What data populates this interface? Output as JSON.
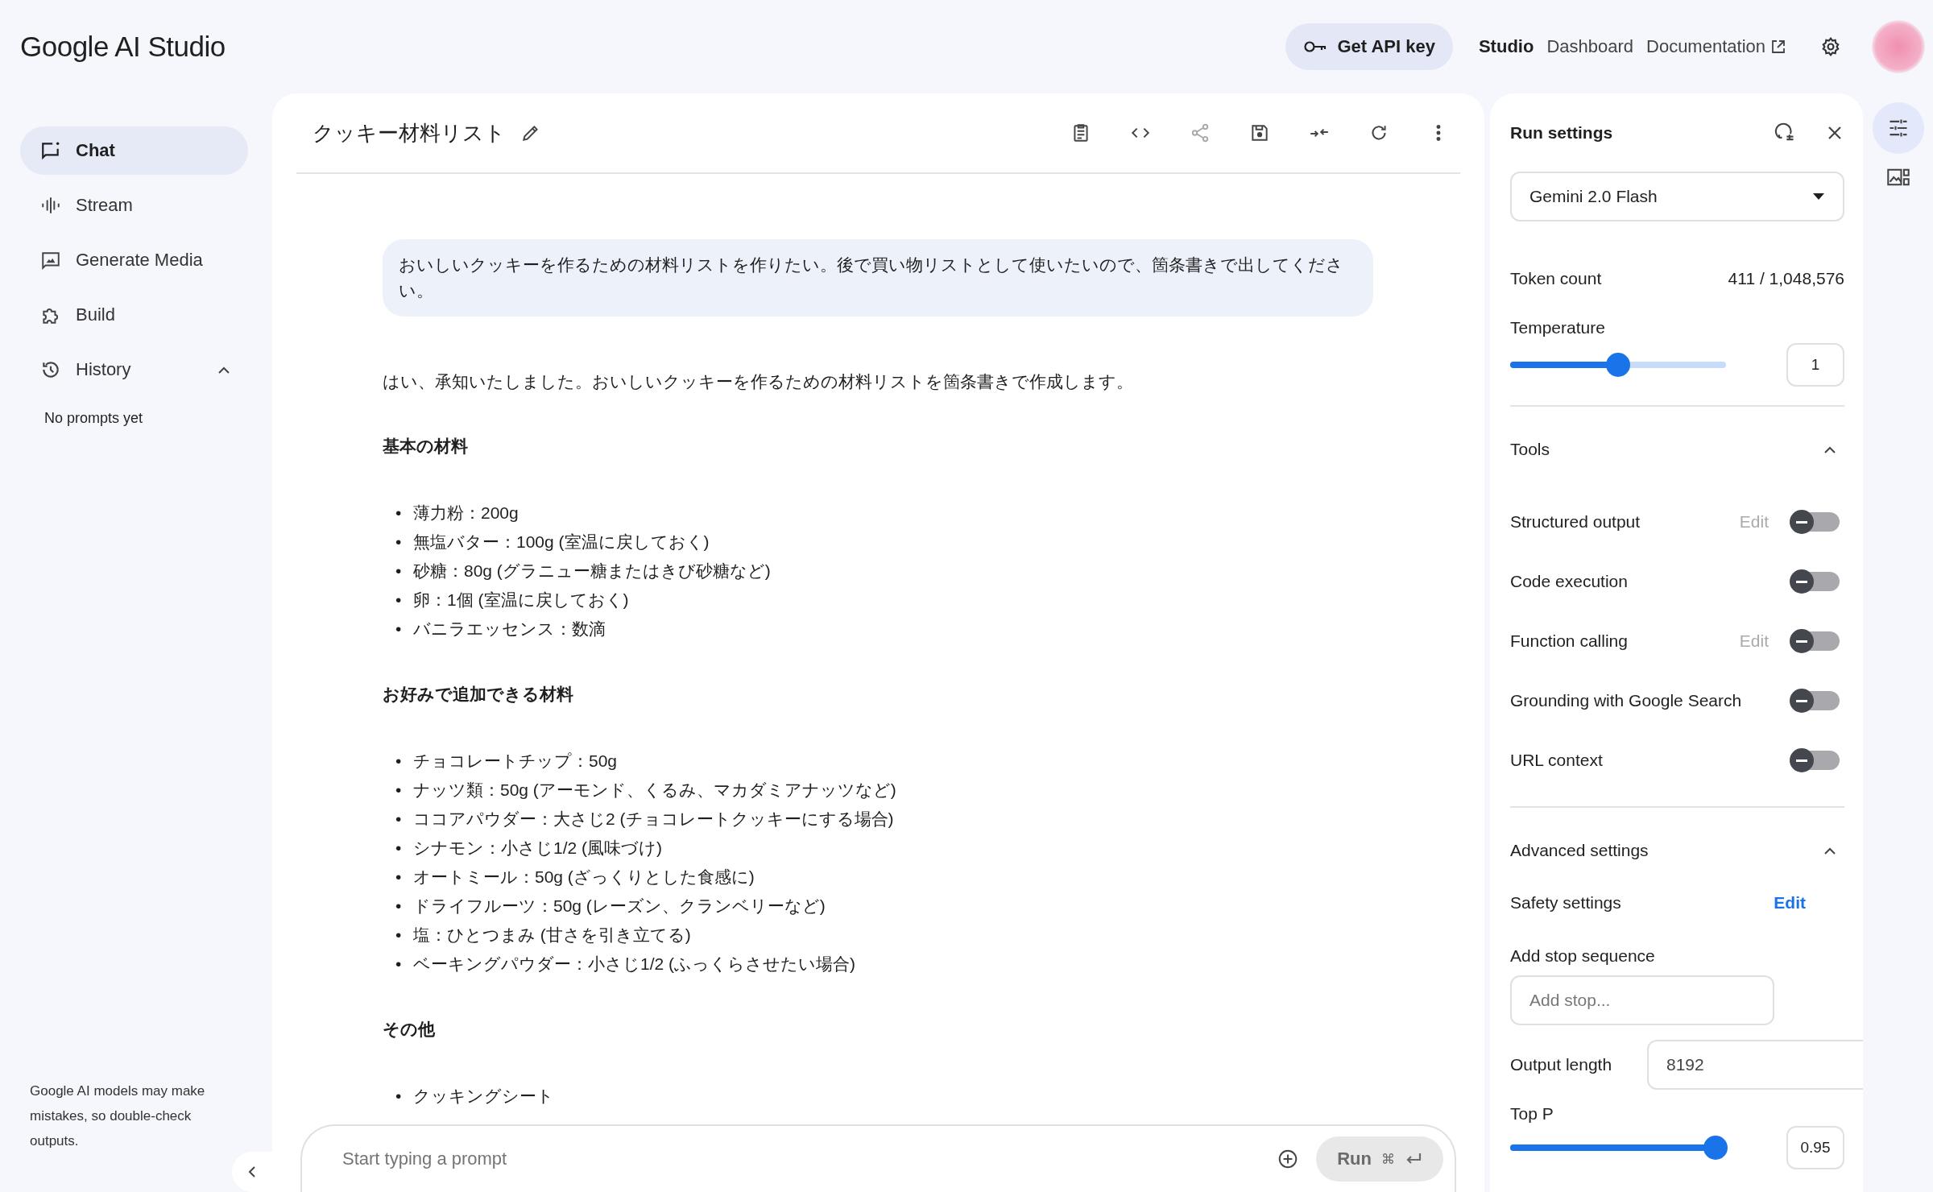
{
  "header": {
    "logo": "Google AI Studio",
    "api_key_button": "Get API key",
    "nav": [
      {
        "label": "Studio",
        "selected": true,
        "external": false
      },
      {
        "label": "Dashboard",
        "selected": false,
        "external": false
      },
      {
        "label": "Documentation",
        "selected": false,
        "external": true
      }
    ]
  },
  "sidebar": {
    "items": [
      {
        "label": "Chat",
        "selected": true
      },
      {
        "label": "Stream",
        "selected": false
      },
      {
        "label": "Generate Media",
        "selected": false
      },
      {
        "label": "Build",
        "selected": false
      },
      {
        "label": "History",
        "selected": false,
        "expanded": true
      }
    ],
    "history_empty": "No prompts yet",
    "disclaimer": "Google AI models may make mistakes, so double-check outputs."
  },
  "chat": {
    "title": "クッキー材料リスト",
    "user_message": "おいしいクッキーを作るための材料リストを作りたい。後で買い物リストとして使いたいので、箇条書きで出してください。",
    "response": [
      {
        "kind": "paragraph",
        "text": "はい、承知いたしました。おいしいクッキーを作るための材料リストを箇条書きで作成します。"
      },
      {
        "kind": "heading",
        "text": "基本の材料"
      },
      {
        "kind": "list",
        "marker": "•",
        "items": [
          "薄力粉：200g",
          "無塩バター：100g (室温に戻しておく)",
          "砂糖：80g (グラニュー糖またはきび砂糖など)",
          "卵：1個 (室温に戻しておく)",
          "バニラエッセンス：数滴"
        ]
      },
      {
        "kind": "heading",
        "text": "お好みで追加できる材料"
      },
      {
        "kind": "list",
        "marker": "•",
        "items": [
          "チョコレートチップ：50g",
          "ナッツ類：50g (アーモンド、くるみ、マカダミアナッツなど)",
          "ココアパウダー：大さじ2 (チョコレートクッキーにする場合)",
          "シナモン：小さじ1/2 (風味づけ)",
          "オートミール：50g (ざっくりとした食感に)",
          "ドライフルーツ：50g (レーズン、クランベリーなど)",
          "塩：ひとつまみ (甘さを引き立てる)",
          "ベーキングパウダー：小さじ1/2 (ふっくらさせたい場合)"
        ]
      },
      {
        "kind": "heading",
        "text": "その他"
      },
      {
        "kind": "list",
        "marker": "•",
        "items": [
          "クッキングシート"
        ]
      }
    ],
    "prompt": {
      "placeholder": "Start typing a prompt"
    },
    "run_button": "Run",
    "shortcut": "⌘"
  },
  "run_settings": {
    "title": "Run settings",
    "model": "Gemini 2.0 Flash",
    "token_count_label": "Token count",
    "token_count": "411 / 1,048,576",
    "temperature": {
      "label": "Temperature",
      "level": 0.5,
      "value": "1"
    },
    "tools": {
      "title": "Tools",
      "expanded": true,
      "items": [
        {
          "label": "Structured output",
          "edit": {
            "label": "Edit",
            "disabled": true
          },
          "on": false
        },
        {
          "label": "Code execution",
          "on": false
        },
        {
          "label": "Function calling",
          "edit": {
            "label": "Edit",
            "disabled": true
          },
          "on": false
        },
        {
          "label": "Grounding with Google Search",
          "on": false
        },
        {
          "label": "URL context",
          "on": false
        }
      ]
    },
    "advanced": {
      "title": "Advanced settings",
      "expanded": true,
      "safety": {
        "label": "Safety settings",
        "edit": {
          "label": "Edit",
          "disabled": false
        }
      },
      "stop_sequence": {
        "label": "Add stop sequence",
        "placeholder": "Add stop..."
      },
      "output_length": {
        "label": "Output length",
        "value": "8192"
      },
      "top_p": {
        "label": "Top P",
        "level": 0.95,
        "value": "0.95"
      }
    }
  }
}
